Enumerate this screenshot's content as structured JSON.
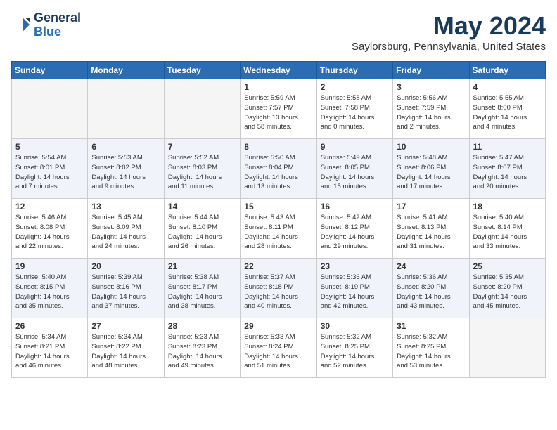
{
  "header": {
    "logo_line1": "General",
    "logo_line2": "Blue",
    "month": "May 2024",
    "location": "Saylorsburg, Pennsylvania, United States"
  },
  "days_of_week": [
    "Sunday",
    "Monday",
    "Tuesday",
    "Wednesday",
    "Thursday",
    "Friday",
    "Saturday"
  ],
  "weeks": [
    [
      {
        "day": "",
        "info": ""
      },
      {
        "day": "",
        "info": ""
      },
      {
        "day": "",
        "info": ""
      },
      {
        "day": "1",
        "info": "Sunrise: 5:59 AM\nSunset: 7:57 PM\nDaylight: 13 hours\nand 58 minutes."
      },
      {
        "day": "2",
        "info": "Sunrise: 5:58 AM\nSunset: 7:58 PM\nDaylight: 14 hours\nand 0 minutes."
      },
      {
        "day": "3",
        "info": "Sunrise: 5:56 AM\nSunset: 7:59 PM\nDaylight: 14 hours\nand 2 minutes."
      },
      {
        "day": "4",
        "info": "Sunrise: 5:55 AM\nSunset: 8:00 PM\nDaylight: 14 hours\nand 4 minutes."
      }
    ],
    [
      {
        "day": "5",
        "info": "Sunrise: 5:54 AM\nSunset: 8:01 PM\nDaylight: 14 hours\nand 7 minutes."
      },
      {
        "day": "6",
        "info": "Sunrise: 5:53 AM\nSunset: 8:02 PM\nDaylight: 14 hours\nand 9 minutes."
      },
      {
        "day": "7",
        "info": "Sunrise: 5:52 AM\nSunset: 8:03 PM\nDaylight: 14 hours\nand 11 minutes."
      },
      {
        "day": "8",
        "info": "Sunrise: 5:50 AM\nSunset: 8:04 PM\nDaylight: 14 hours\nand 13 minutes."
      },
      {
        "day": "9",
        "info": "Sunrise: 5:49 AM\nSunset: 8:05 PM\nDaylight: 14 hours\nand 15 minutes."
      },
      {
        "day": "10",
        "info": "Sunrise: 5:48 AM\nSunset: 8:06 PM\nDaylight: 14 hours\nand 17 minutes."
      },
      {
        "day": "11",
        "info": "Sunrise: 5:47 AM\nSunset: 8:07 PM\nDaylight: 14 hours\nand 20 minutes."
      }
    ],
    [
      {
        "day": "12",
        "info": "Sunrise: 5:46 AM\nSunset: 8:08 PM\nDaylight: 14 hours\nand 22 minutes."
      },
      {
        "day": "13",
        "info": "Sunrise: 5:45 AM\nSunset: 8:09 PM\nDaylight: 14 hours\nand 24 minutes."
      },
      {
        "day": "14",
        "info": "Sunrise: 5:44 AM\nSunset: 8:10 PM\nDaylight: 14 hours\nand 26 minutes."
      },
      {
        "day": "15",
        "info": "Sunrise: 5:43 AM\nSunset: 8:11 PM\nDaylight: 14 hours\nand 28 minutes."
      },
      {
        "day": "16",
        "info": "Sunrise: 5:42 AM\nSunset: 8:12 PM\nDaylight: 14 hours\nand 29 minutes."
      },
      {
        "day": "17",
        "info": "Sunrise: 5:41 AM\nSunset: 8:13 PM\nDaylight: 14 hours\nand 31 minutes."
      },
      {
        "day": "18",
        "info": "Sunrise: 5:40 AM\nSunset: 8:14 PM\nDaylight: 14 hours\nand 33 minutes."
      }
    ],
    [
      {
        "day": "19",
        "info": "Sunrise: 5:40 AM\nSunset: 8:15 PM\nDaylight: 14 hours\nand 35 minutes."
      },
      {
        "day": "20",
        "info": "Sunrise: 5:39 AM\nSunset: 8:16 PM\nDaylight: 14 hours\nand 37 minutes."
      },
      {
        "day": "21",
        "info": "Sunrise: 5:38 AM\nSunset: 8:17 PM\nDaylight: 14 hours\nand 38 minutes."
      },
      {
        "day": "22",
        "info": "Sunrise: 5:37 AM\nSunset: 8:18 PM\nDaylight: 14 hours\nand 40 minutes."
      },
      {
        "day": "23",
        "info": "Sunrise: 5:36 AM\nSunset: 8:19 PM\nDaylight: 14 hours\nand 42 minutes."
      },
      {
        "day": "24",
        "info": "Sunrise: 5:36 AM\nSunset: 8:20 PM\nDaylight: 14 hours\nand 43 minutes."
      },
      {
        "day": "25",
        "info": "Sunrise: 5:35 AM\nSunset: 8:20 PM\nDaylight: 14 hours\nand 45 minutes."
      }
    ],
    [
      {
        "day": "26",
        "info": "Sunrise: 5:34 AM\nSunset: 8:21 PM\nDaylight: 14 hours\nand 46 minutes."
      },
      {
        "day": "27",
        "info": "Sunrise: 5:34 AM\nSunset: 8:22 PM\nDaylight: 14 hours\nand 48 minutes."
      },
      {
        "day": "28",
        "info": "Sunrise: 5:33 AM\nSunset: 8:23 PM\nDaylight: 14 hours\nand 49 minutes."
      },
      {
        "day": "29",
        "info": "Sunrise: 5:33 AM\nSunset: 8:24 PM\nDaylight: 14 hours\nand 51 minutes."
      },
      {
        "day": "30",
        "info": "Sunrise: 5:32 AM\nSunset: 8:25 PM\nDaylight: 14 hours\nand 52 minutes."
      },
      {
        "day": "31",
        "info": "Sunrise: 5:32 AM\nSunset: 8:25 PM\nDaylight: 14 hours\nand 53 minutes."
      },
      {
        "day": "",
        "info": ""
      }
    ]
  ]
}
